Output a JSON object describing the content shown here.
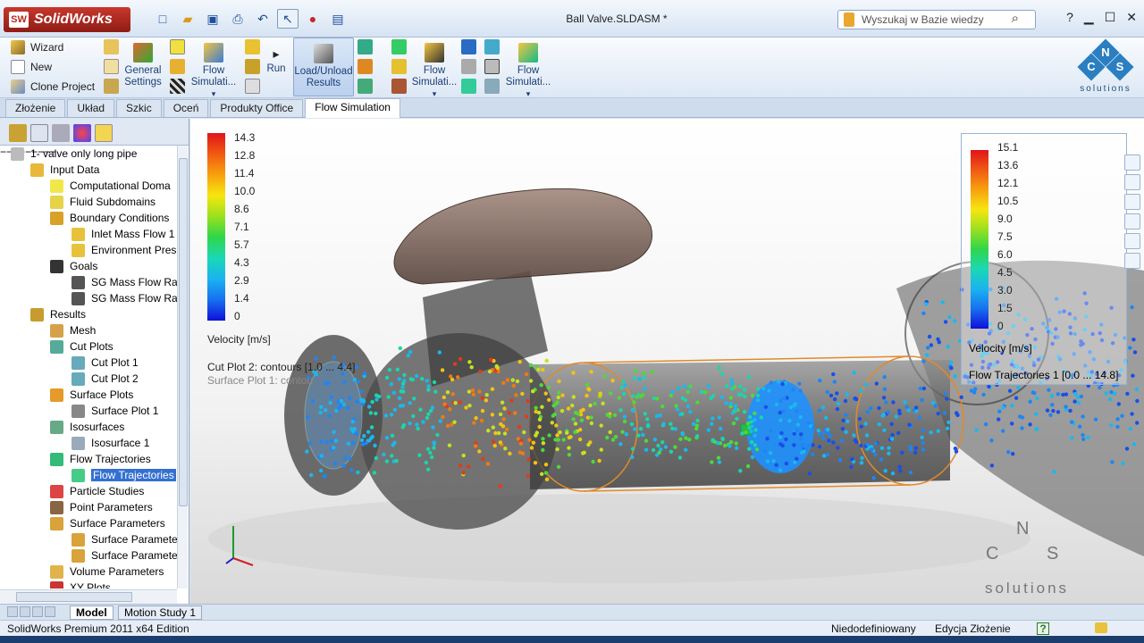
{
  "app": {
    "brand": "SolidWorks",
    "doc_title": "Ball Valve.SLDASM *",
    "search_placeholder": "Wyszukaj w Bazie wiedzy",
    "help": "?"
  },
  "command_manager": {
    "small_buttons": [
      "Wizard",
      "New",
      "Clone Project"
    ],
    "general_settings": "General Settings",
    "flow_sim_1": "Flow Simulati...",
    "run": "Run",
    "load_unload": "Load/Unload Results",
    "flow_sim_2": "Flow Simulati...",
    "flow_sim_3": "Flow Simulati...",
    "brand_letters": [
      "N",
      "C",
      "S"
    ],
    "brand_sub": "solutions"
  },
  "tabs": [
    "Złożenie",
    "Układ",
    "Szkic",
    "Oceń",
    "Produkty Office",
    "Flow Simulation"
  ],
  "tree": {
    "root": "1- valve only long pipe",
    "items": [
      {
        "label": "Input Data",
        "level": 1,
        "icon": "folder-icon"
      },
      {
        "label": "Computational Doma",
        "level": 2,
        "icon": "domain-icon"
      },
      {
        "label": "Fluid Subdomains",
        "level": 2,
        "icon": "subdomain-icon"
      },
      {
        "label": "Boundary Conditions",
        "level": 2,
        "icon": "boundary-conditions-icon"
      },
      {
        "label": "Inlet Mass Flow 1",
        "level": 3,
        "icon": "inlet-icon"
      },
      {
        "label": "Environment Pres",
        "level": 3,
        "icon": "pressure-icon"
      },
      {
        "label": "Goals",
        "level": 2,
        "icon": "goals-flag-icon"
      },
      {
        "label": "SG Mass Flow Rat",
        "level": 3,
        "icon": "goal-icon"
      },
      {
        "label": "SG Mass Flow Rat",
        "level": 3,
        "icon": "goal-icon"
      },
      {
        "label": "Results",
        "level": 1,
        "icon": "results-icon"
      },
      {
        "label": "Mesh",
        "level": 2,
        "icon": "mesh-icon"
      },
      {
        "label": "Cut Plots",
        "level": 2,
        "icon": "cut-plots-icon"
      },
      {
        "label": "Cut Plot 1",
        "level": 3,
        "icon": "cut-plot-icon"
      },
      {
        "label": "Cut Plot 2",
        "level": 3,
        "icon": "cut-plot-icon"
      },
      {
        "label": "Surface Plots",
        "level": 2,
        "icon": "surface-plots-icon"
      },
      {
        "label": "Surface Plot 1",
        "level": 3,
        "icon": "surface-plot-icon"
      },
      {
        "label": "Isosurfaces",
        "level": 2,
        "icon": "isosurfaces-icon"
      },
      {
        "label": "Isosurface 1",
        "level": 3,
        "icon": "isosurface-icon"
      },
      {
        "label": "Flow Trajectories",
        "level": 2,
        "icon": "flow-trajectories-icon"
      },
      {
        "label": "Flow Trajectories",
        "level": 3,
        "icon": "flow-trajectory-icon",
        "selected": true
      },
      {
        "label": "Particle Studies",
        "level": 2,
        "icon": "particle-studies-icon"
      },
      {
        "label": "Point Parameters",
        "level": 2,
        "icon": "point-parameters-icon"
      },
      {
        "label": "Surface Parameters",
        "level": 2,
        "icon": "surface-parameters-icon"
      },
      {
        "label": "Surface Paramete",
        "level": 3,
        "icon": "surface-parameter-icon"
      },
      {
        "label": "Surface Paramete",
        "level": 3,
        "icon": "surface-parameter-icon"
      },
      {
        "label": "Volume Parameters",
        "level": 2,
        "icon": "volume-parameters-icon"
      },
      {
        "label": "XY Plots",
        "level": 2,
        "icon": "xy-plots-icon"
      }
    ]
  },
  "viewport": {
    "left_legend": {
      "ticks": [
        "14.3",
        "12.8",
        "11.4",
        "10.0",
        "8.6",
        "7.1",
        "5.7",
        "4.3",
        "2.9",
        "1.4",
        "0"
      ],
      "title": "Velocity [m/s]",
      "line1": "Cut Plot 2: contours [1.0 ... 4.4]",
      "line2": "Surface Plot 1: contou"
    },
    "right_legend": {
      "ticks": [
        "15.1",
        "13.6",
        "12.1",
        "10.5",
        "9.0",
        "7.5",
        "6.0",
        "4.5",
        "3.0",
        "1.5",
        "0"
      ],
      "title": "Velocity [m/s]",
      "line1": "Flow Trajectories 1 [0.0 ... 14.8]"
    },
    "watermark_letters": [
      "N",
      "C",
      "S"
    ],
    "watermark_sub": "solutions",
    "colors": {
      "pipe": "#5a5a5a",
      "outline": "#e08a2a",
      "disk": "#1e90ff"
    }
  },
  "bottom_tabs": [
    "Model",
    "Motion Study 1"
  ],
  "status": {
    "left": "SolidWorks Premium 2011 x64 Edition",
    "state": "Niedodefiniowany",
    "mode": "Edycja Złożenie",
    "help_icon": "?"
  }
}
